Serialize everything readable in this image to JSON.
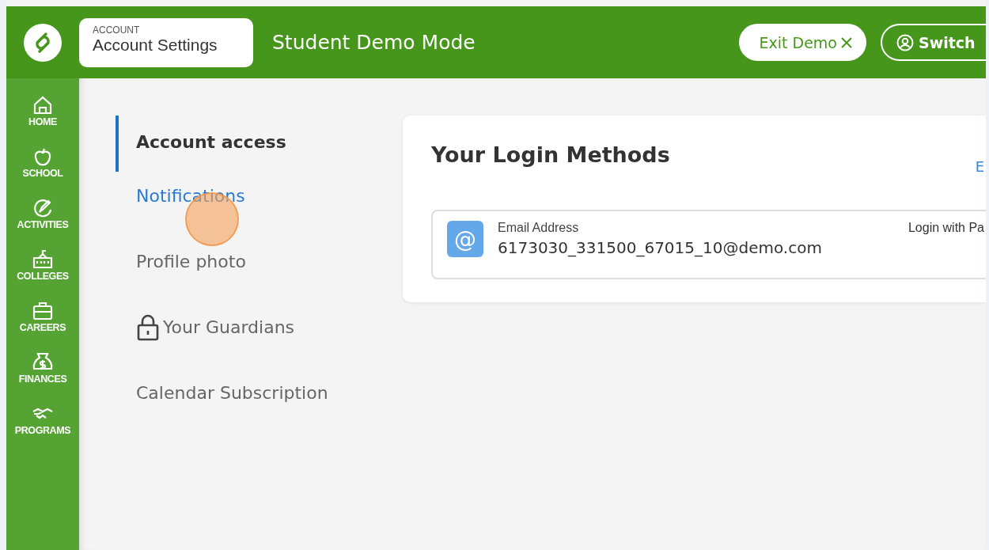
{
  "header": {
    "breadcrumb": {
      "section": "ACCOUNT",
      "title": "Account Settings"
    },
    "mode_title": "Student Demo Mode",
    "exit_button": "Exit Demo",
    "switch_button": "Switch"
  },
  "sidebar": {
    "items": [
      {
        "label": "HOME",
        "kind": "home"
      },
      {
        "label": "SCHOOL",
        "kind": "school"
      },
      {
        "label": "ACTIVITIES",
        "kind": "activities"
      },
      {
        "label": "COLLEGES",
        "kind": "colleges"
      },
      {
        "label": "CAREERS",
        "kind": "careers"
      },
      {
        "label": "FINANCES",
        "kind": "finances"
      },
      {
        "label": "PROGRAMS",
        "kind": "programs"
      }
    ]
  },
  "settings_nav": [
    {
      "label": "Account access",
      "selected": true,
      "hovered": false,
      "locked": false
    },
    {
      "label": "Notifications",
      "selected": false,
      "hovered": true,
      "locked": false
    },
    {
      "label": "Profile photo",
      "selected": false,
      "hovered": false,
      "locked": false
    },
    {
      "label": "Your Guardians",
      "selected": false,
      "hovered": false,
      "locked": true
    },
    {
      "label": "Calendar Subscription",
      "selected": false,
      "hovered": false,
      "locked": false
    }
  ],
  "login_card": {
    "title": "Your Login Methods",
    "edit_link": "E",
    "methods": [
      {
        "icon_glyph": "@",
        "label": "Email Address",
        "value": "6173030_331500_67015_10@demo.com",
        "status": "Login with Pa"
      }
    ]
  }
}
